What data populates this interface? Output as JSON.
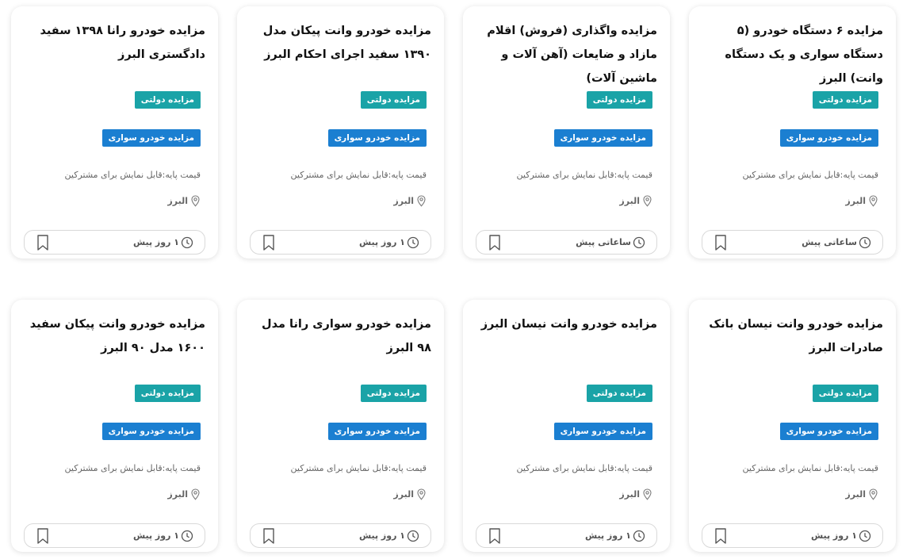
{
  "cards": [
    {
      "title": "مزایده ۶ دستگاه خودرو (۵ دستگاه سواری و یک دستگاه وانت) البرز",
      "badge_gov": "مزایده دولتی",
      "badge_car": "مزایده خودرو سواری",
      "price": "قیمت پایه:قابل نمایش برای مشترکین",
      "location": "البرز",
      "time": "ساعاتی پیش"
    },
    {
      "title": "مزایده واگذاری (فروش) اقلام مازاد و ضایعات (آهن آلات و ماشین آلات)",
      "badge_gov": "مزایده دولتی",
      "badge_car": "مزایده خودرو سواری",
      "price": "قیمت پایه:قابل نمایش برای مشترکین",
      "location": "البرز",
      "time": "ساعاتی پیش"
    },
    {
      "title": "مزایده خودرو وانت پیکان مدل ۱۳۹۰ سفید اجرای احکام البرز",
      "badge_gov": "مزایده دولتی",
      "badge_car": "مزایده خودرو سواری",
      "price": "قیمت پایه:قابل نمایش برای مشترکین",
      "location": "البرز",
      "time": "۱ روز پیش"
    },
    {
      "title": "مزایده خودرو رانا ۱۳۹۸ سفید دادگستری البرز",
      "badge_gov": "مزایده دولتی",
      "badge_car": "مزایده خودرو سواری",
      "price": "قیمت پایه:قابل نمایش برای مشترکین",
      "location": "البرز",
      "time": "۱ روز پیش"
    },
    {
      "title": "مزایده خودرو وانت نیسان بانک صادرات البرز",
      "badge_gov": "مزایده دولتی",
      "badge_car": "مزایده خودرو سواری",
      "price": "قیمت پایه:قابل نمایش برای مشترکین",
      "location": "البرز",
      "time": "۱ روز پیش"
    },
    {
      "title": "مزایده خودرو وانت نیسان البرز",
      "badge_gov": "مزایده دولتی",
      "badge_car": "مزایده خودرو سواری",
      "price": "قیمت پایه:قابل نمایش برای مشترکین",
      "location": "البرز",
      "time": "۱ روز پیش"
    },
    {
      "title": "مزایده خودرو سواری رانا مدل ۹۸ البرز",
      "badge_gov": "مزایده دولتی",
      "badge_car": "مزایده خودرو سواری",
      "price": "قیمت پایه:قابل نمایش برای مشترکین",
      "location": "البرز",
      "time": "۱ روز پیش"
    },
    {
      "title": "مزایده خودرو وانت پیکان سفید ۱۶۰۰ مدل ۹۰ البرز",
      "badge_gov": "مزایده دولتی",
      "badge_car": "مزایده خودرو سواری",
      "price": "قیمت پایه:قابل نمایش برای مشترکین",
      "location": "البرز",
      "time": "۱ روز پیش"
    }
  ]
}
